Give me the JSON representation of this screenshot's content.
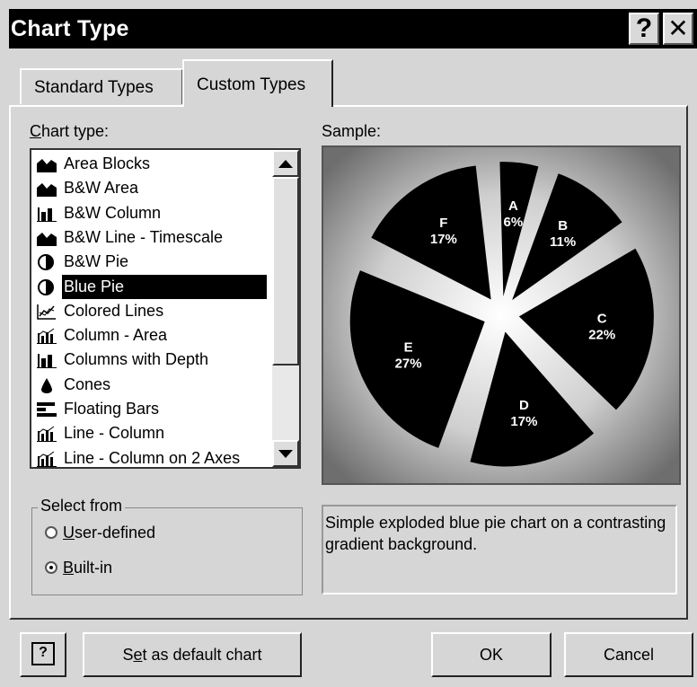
{
  "dialog": {
    "title": "Chart Type",
    "help_glyph": "?",
    "close_glyph": "✕"
  },
  "tabs": [
    {
      "label": "Standard Types",
      "active": false
    },
    {
      "label": "Custom Types",
      "active": true
    }
  ],
  "chart_type_list": {
    "label_accel": "C",
    "label_rest": "hart type:",
    "items": [
      {
        "label": "Area Blocks",
        "icon": "area-chart-icon"
      },
      {
        "label": "B&W Area",
        "icon": "area-chart-icon"
      },
      {
        "label": "B&W Column",
        "icon": "column-chart-icon"
      },
      {
        "label": "B&W Line - Timescale",
        "icon": "area-chart-icon"
      },
      {
        "label": "B&W Pie",
        "icon": "pie-chart-icon"
      },
      {
        "label": "Blue Pie",
        "icon": "pie-chart-icon",
        "selected": true
      },
      {
        "label": "Colored Lines",
        "icon": "line-chart-icon"
      },
      {
        "label": "Column - Area",
        "icon": "column-area-chart-icon"
      },
      {
        "label": "Columns with Depth",
        "icon": "column-chart-icon"
      },
      {
        "label": "Cones",
        "icon": "cone-chart-icon"
      },
      {
        "label": "Floating Bars",
        "icon": "bar-chart-icon"
      },
      {
        "label": "Line - Column",
        "icon": "column-area-chart-icon"
      },
      {
        "label": "Line - Column on 2 Axes",
        "icon": "column-area-chart-icon"
      }
    ]
  },
  "sample": {
    "label": "Sample:",
    "chart_data": {
      "type": "pie",
      "categories": [
        "A",
        "B",
        "C",
        "D",
        "E",
        "F"
      ],
      "values": [
        6,
        11,
        22,
        17,
        27,
        17
      ],
      "data_labels": [
        "6%",
        "11%",
        "22%",
        "17%",
        "27%",
        "17%"
      ],
      "exploded": true,
      "slice_color": "#000000",
      "background": "gradient"
    }
  },
  "select_from": {
    "legend": "Select from",
    "options": [
      {
        "accel": "U",
        "rest": "ser-defined",
        "checked": false
      },
      {
        "accel": "B",
        "rest": "uilt-in",
        "checked": true
      }
    ]
  },
  "description": "Simple exploded blue pie chart on a contrasting gradient background.",
  "buttons": {
    "help_glyph": "?",
    "set_default_pre": "S",
    "set_default_accel": "e",
    "set_default_post": "t as default chart",
    "ok": "OK",
    "cancel": "Cancel"
  },
  "colors": {
    "face": "#d6d6d6",
    "title_bg": "#000000",
    "selection": "#000000"
  }
}
